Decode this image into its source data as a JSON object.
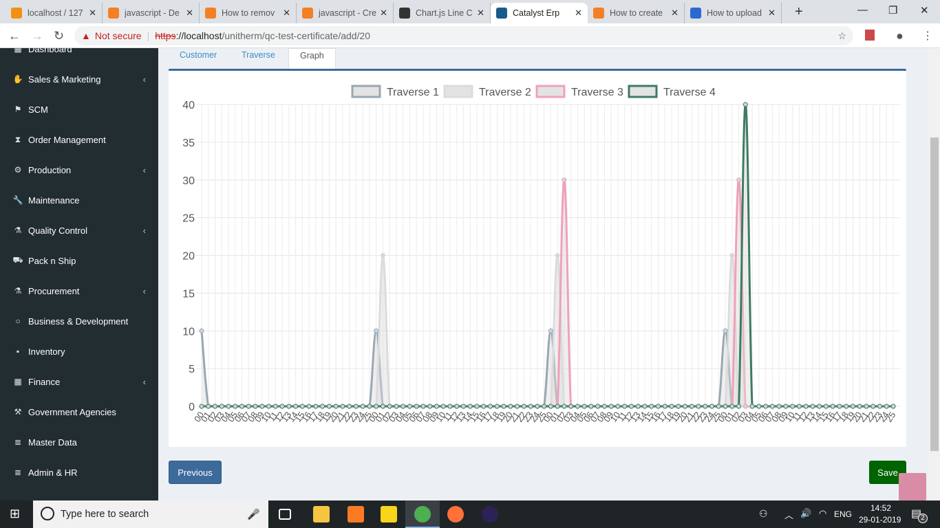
{
  "browser": {
    "tabs": [
      {
        "title": "localhost / 127",
        "icon": "phpmyadmin-icon",
        "color": "#f29111"
      },
      {
        "title": "javascript - De",
        "icon": "stackoverflow-icon",
        "color": "#f48024"
      },
      {
        "title": "How to remov",
        "icon": "stackoverflow-icon",
        "color": "#f48024"
      },
      {
        "title": "javascript - Cre",
        "icon": "stackoverflow-icon",
        "color": "#f48024"
      },
      {
        "title": "Chart.js Line C",
        "icon": "codepen-icon",
        "color": "#333333"
      },
      {
        "title": "Catalyst Erp",
        "icon": "catalyst-icon",
        "color": "#1a5a8a",
        "active": true
      },
      {
        "title": "How to create",
        "icon": "stackoverflow-icon",
        "color": "#f48024"
      },
      {
        "title": "How to upload",
        "icon": "page-icon",
        "color": "#2a6ad0"
      }
    ],
    "close_glyph": "✕",
    "new_tab": "+",
    "security": "Not secure",
    "url_scheme": "https",
    "url_host": "://localhost",
    "url_path": "/unitherm/qc-test-certificate/add/20"
  },
  "sidebar": {
    "items": [
      {
        "label": "Dashboard",
        "icon": "dashboard-icon",
        "glyph": "▦"
      },
      {
        "label": "Sales & Marketing",
        "icon": "handshake-icon",
        "glyph": "✋",
        "chevron": true
      },
      {
        "label": "SCM",
        "icon": "flag-icon",
        "glyph": "⚑"
      },
      {
        "label": "Order Management",
        "icon": "hourglass-icon",
        "glyph": "⧗"
      },
      {
        "label": "Production",
        "icon": "cogs-icon",
        "glyph": "⚙",
        "chevron": true
      },
      {
        "label": "Maintenance",
        "icon": "wrench-icon",
        "glyph": "🔧"
      },
      {
        "label": "Quality Control",
        "icon": "flask-icon",
        "glyph": "⚗",
        "chevron": true
      },
      {
        "label": "Pack n Ship",
        "icon": "truck-icon",
        "glyph": "⛟"
      },
      {
        "label": "Procurement",
        "icon": "flask-icon",
        "glyph": "⚗",
        "chevron": true
      },
      {
        "label": "Business & Development",
        "icon": "circle-icon",
        "glyph": "○"
      },
      {
        "label": "Inventory",
        "icon": "box-icon",
        "glyph": "▪"
      },
      {
        "label": "Finance",
        "icon": "calculator-icon",
        "glyph": "▦",
        "chevron": true
      },
      {
        "label": "Government Agencies",
        "icon": "gavel-icon",
        "glyph": "⚒"
      },
      {
        "label": "Master Data",
        "icon": "database-icon",
        "glyph": "≣"
      },
      {
        "label": "Admin & HR",
        "icon": "database-icon",
        "glyph": "≣"
      }
    ]
  },
  "page_tabs": [
    {
      "label": "Customer"
    },
    {
      "label": "Traverse"
    },
    {
      "label": "Graph",
      "active": true
    }
  ],
  "buttons": {
    "previous": "Previous",
    "save": "Save"
  },
  "chart_data": {
    "type": "line",
    "ylim": [
      0,
      40
    ],
    "yticks": [
      0,
      5,
      10,
      15,
      20,
      25,
      30,
      35,
      40
    ],
    "grid": true,
    "legend": "top",
    "categories": [
      "00",
      "01",
      "02",
      "03",
      "04",
      "05",
      "06",
      "07",
      "08",
      "09",
      "10",
      "11",
      "12",
      "13",
      "14",
      "15",
      "16",
      "17",
      "18",
      "19",
      "20",
      "21",
      "22",
      "23",
      "24",
      "25",
      "00",
      "01",
      "02",
      "03",
      "04",
      "05",
      "06",
      "07",
      "08",
      "09",
      "10",
      "11",
      "12",
      "13",
      "14",
      "15",
      "16",
      "17",
      "18",
      "19",
      "20",
      "21",
      "22",
      "23",
      "24",
      "25",
      "00",
      "01",
      "02",
      "03",
      "04",
      "05",
      "06",
      "07",
      "08",
      "09",
      "10",
      "11",
      "12",
      "13",
      "14",
      "15",
      "16",
      "17",
      "18",
      "19",
      "20",
      "21",
      "22",
      "23",
      "24",
      "25",
      "00",
      "01",
      "02",
      "03",
      "04",
      "05",
      "06",
      "07",
      "08",
      "09",
      "10",
      "11",
      "12",
      "13",
      "14",
      "15",
      "16",
      "17",
      "18",
      "19",
      "20",
      "21",
      "22",
      "23",
      "24",
      "25"
    ],
    "series": [
      {
        "name": "Traverse 1",
        "color": "#97a7b4",
        "values": [
          10,
          0,
          0,
          0,
          0,
          0,
          0,
          0,
          0,
          0,
          0,
          0,
          0,
          0,
          0,
          0,
          0,
          0,
          0,
          0,
          0,
          0,
          0,
          0,
          0,
          0,
          10,
          0,
          0,
          0,
          0,
          0,
          0,
          0,
          0,
          0,
          0,
          0,
          0,
          0,
          0,
          0,
          0,
          0,
          0,
          0,
          0,
          0,
          0,
          0,
          0,
          0,
          10,
          0,
          0,
          0,
          0,
          0,
          0,
          0,
          0,
          0,
          0,
          0,
          0,
          0,
          0,
          0,
          0,
          0,
          0,
          0,
          0,
          0,
          0,
          0,
          0,
          0,
          10,
          0,
          0,
          0,
          0,
          0,
          0,
          0,
          0,
          0,
          0,
          0,
          0,
          0,
          0,
          0,
          0,
          0,
          0,
          0,
          0,
          0,
          0,
          0,
          0,
          0
        ]
      },
      {
        "name": "Traverse 2",
        "color": "#dcdcdc",
        "values": [
          0,
          0,
          0,
          0,
          0,
          0,
          0,
          0,
          0,
          0,
          0,
          0,
          0,
          0,
          0,
          0,
          0,
          0,
          0,
          0,
          0,
          0,
          0,
          0,
          0,
          0,
          0,
          20,
          0,
          0,
          0,
          0,
          0,
          0,
          0,
          0,
          0,
          0,
          0,
          0,
          0,
          0,
          0,
          0,
          0,
          0,
          0,
          0,
          0,
          0,
          0,
          0,
          0,
          20,
          0,
          0,
          0,
          0,
          0,
          0,
          0,
          0,
          0,
          0,
          0,
          0,
          0,
          0,
          0,
          0,
          0,
          0,
          0,
          0,
          0,
          0,
          0,
          0,
          0,
          20,
          0,
          0,
          0,
          0,
          0,
          0,
          0,
          0,
          0,
          0,
          0,
          0,
          0,
          0,
          0,
          0,
          0,
          0,
          0,
          0,
          0,
          0,
          0,
          0
        ]
      },
      {
        "name": "Traverse 3",
        "color": "#f0a0b8",
        "values": [
          0,
          0,
          0,
          0,
          0,
          0,
          0,
          0,
          0,
          0,
          0,
          0,
          0,
          0,
          0,
          0,
          0,
          0,
          0,
          0,
          0,
          0,
          0,
          0,
          0,
          0,
          0,
          0,
          0,
          0,
          0,
          0,
          0,
          0,
          0,
          0,
          0,
          0,
          0,
          0,
          0,
          0,
          0,
          0,
          0,
          0,
          0,
          0,
          0,
          0,
          0,
          0,
          0,
          0,
          30,
          0,
          0,
          0,
          0,
          0,
          0,
          0,
          0,
          0,
          0,
          0,
          0,
          0,
          0,
          0,
          0,
          0,
          0,
          0,
          0,
          0,
          0,
          0,
          0,
          0,
          30,
          0,
          0,
          0,
          0,
          0,
          0,
          0,
          0,
          0,
          0,
          0,
          0,
          0,
          0,
          0,
          0,
          0,
          0,
          0,
          0,
          0,
          0,
          0
        ]
      },
      {
        "name": "Traverse 4",
        "color": "#3e7b60",
        "values": [
          0,
          0,
          0,
          0,
          0,
          0,
          0,
          0,
          0,
          0,
          0,
          0,
          0,
          0,
          0,
          0,
          0,
          0,
          0,
          0,
          0,
          0,
          0,
          0,
          0,
          0,
          0,
          0,
          0,
          0,
          0,
          0,
          0,
          0,
          0,
          0,
          0,
          0,
          0,
          0,
          0,
          0,
          0,
          0,
          0,
          0,
          0,
          0,
          0,
          0,
          0,
          0,
          0,
          0,
          0,
          0,
          0,
          0,
          0,
          0,
          0,
          0,
          0,
          0,
          0,
          0,
          0,
          0,
          0,
          0,
          0,
          0,
          0,
          0,
          0,
          0,
          0,
          0,
          0,
          0,
          0,
          40,
          0,
          0,
          0,
          0,
          0,
          0,
          0,
          0,
          0,
          0,
          0,
          0,
          0,
          0,
          0,
          0,
          0,
          0,
          0,
          0,
          0,
          0
        ]
      }
    ]
  },
  "taskbar": {
    "search_placeholder": "Type here to search",
    "apps": [
      {
        "icon": "task-view-icon",
        "color": "#ffffff"
      },
      {
        "icon": "file-explorer-icon",
        "color": "#f5c542"
      },
      {
        "icon": "xampp-icon",
        "color": "#fb7a24"
      },
      {
        "icon": "sticky-notes-icon",
        "color": "#f7d51a"
      },
      {
        "icon": "chrome-icon",
        "color": "#4caf50",
        "active": true
      },
      {
        "icon": "firefox-icon",
        "color": "#ff7139"
      },
      {
        "icon": "eclipse-icon",
        "color": "#2c2255"
      }
    ],
    "language": "ENG",
    "time": "14:52",
    "date": "29-01-2019",
    "notifications": "2"
  }
}
